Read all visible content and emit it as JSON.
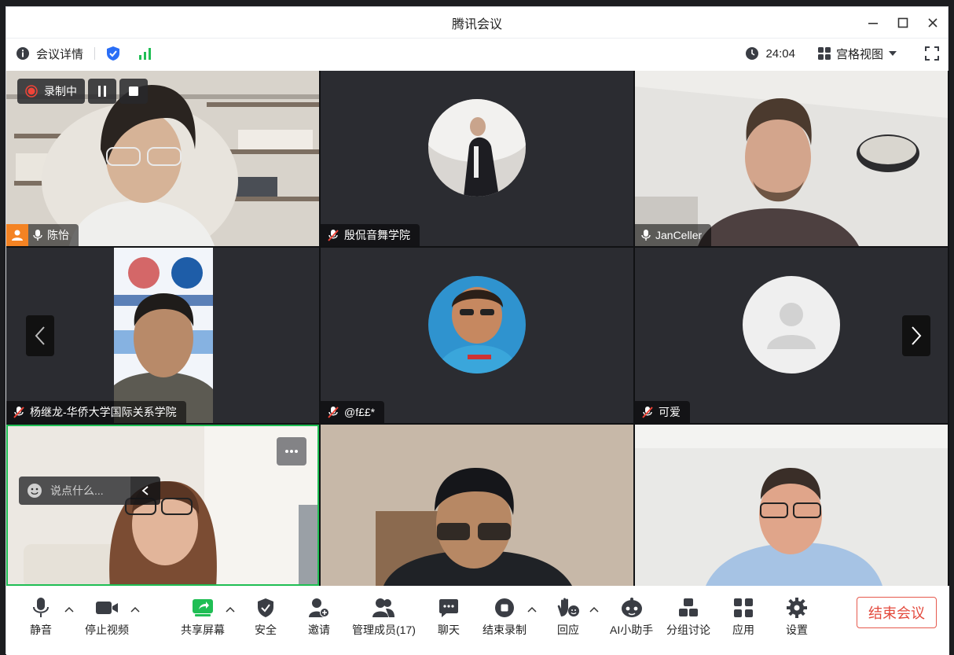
{
  "window": {
    "title": "腾讯会议"
  },
  "infobar": {
    "meeting_details": "会议详情",
    "timer": "24:04",
    "view_mode": "宫格视图"
  },
  "recording": {
    "status": "录制中"
  },
  "participants": [
    {
      "name": "陈怡",
      "mic": "on",
      "host": true
    },
    {
      "name": "殷侃音舞学院",
      "mic": "muted"
    },
    {
      "name": "JanCeller",
      "mic": "on"
    },
    {
      "name": "杨继龙-华侨大学国际关系学院",
      "mic": "muted"
    },
    {
      "name": "@f££*",
      "mic": "muted"
    },
    {
      "name": "可爱",
      "mic": "muted"
    },
    {
      "name": "",
      "mic": "on",
      "speaking": true
    },
    {
      "name": "",
      "mic": "muted"
    },
    {
      "name": "",
      "mic": "muted"
    }
  ],
  "chat": {
    "placeholder": "说点什么..."
  },
  "toolbar": {
    "mute": "静音",
    "stop_video": "停止视频",
    "share_screen": "共享屏幕",
    "security": "安全",
    "invite": "邀请",
    "manage_members": "管理成员(17)",
    "chat": "聊天",
    "end_recording": "结束录制",
    "reaction": "回应",
    "ai_assistant": "AI小助手",
    "breakout": "分组讨论",
    "apps": "应用",
    "settings": "设置",
    "end_meeting": "结束会议"
  },
  "colors": {
    "accent_green": "#1fbe54",
    "recording_red": "#f04438",
    "end_red": "#e3493c",
    "host_orange": "#f48323",
    "shield_blue": "#2a6ef6"
  }
}
